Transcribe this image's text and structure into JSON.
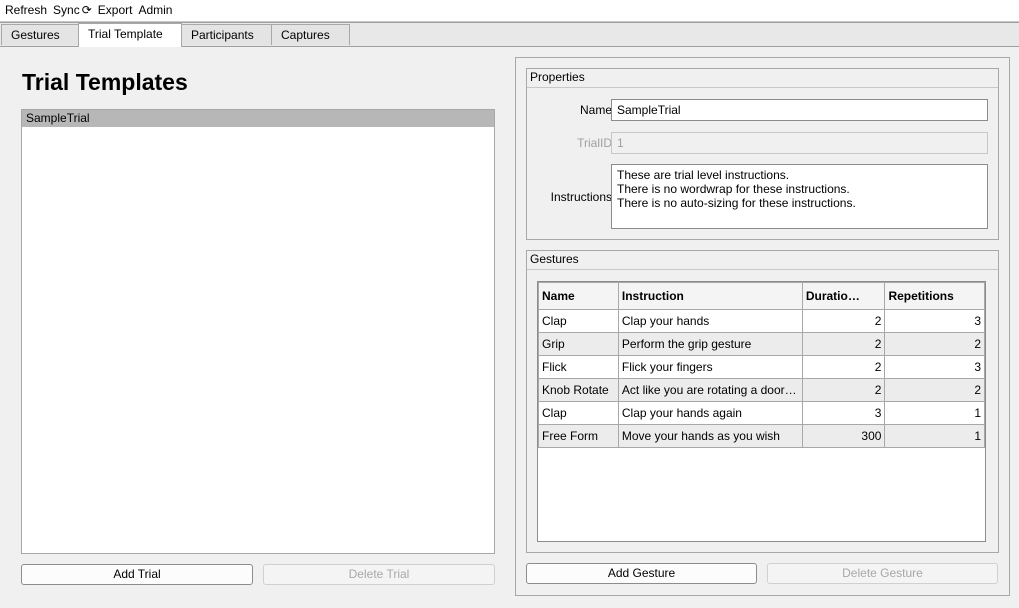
{
  "menu": {
    "refresh": "Refresh",
    "sync": "Sync",
    "sync_icon": "⟳",
    "export": "Export",
    "admin": "Admin"
  },
  "tabs": [
    "Gestures",
    "Trial Template",
    "Participants",
    "Captures"
  ],
  "active_tab": "Trial Template",
  "left": {
    "title": "Trial Templates",
    "list_items": [
      "SampleTrial"
    ],
    "add_button": "Add Trial",
    "delete_button": "Delete Trial"
  },
  "properties": {
    "title": "Properties",
    "name_label": "Name",
    "name_value": "SampleTrial",
    "trialid_label": "TrialID",
    "trialid_value": "1",
    "instructions_label": "Instructions",
    "instructions_lines": [
      "These are trial level instructions.",
      "There is no wordwrap for these instructions.",
      "There is no auto-sizing for these instructions."
    ]
  },
  "gestures": {
    "title": "Gestures",
    "columns": [
      "Name",
      "Instruction",
      "Duratio…",
      "Repetitions"
    ],
    "rows": [
      {
        "name": "Clap",
        "instruction": "Clap your hands",
        "duration": "2",
        "repetitions": "3"
      },
      {
        "name": "Grip",
        "instruction": "Perform the grip gesture",
        "duration": "2",
        "repetitions": "2"
      },
      {
        "name": "Flick",
        "instruction": "Flick your fingers",
        "duration": "2",
        "repetitions": "3"
      },
      {
        "name": "Knob Rotate",
        "instruction": "Act like you are rotating a door…",
        "duration": "2",
        "repetitions": "2"
      },
      {
        "name": "Clap",
        "instruction": "Clap your hands again",
        "duration": "3",
        "repetitions": "1"
      },
      {
        "name": "Free Form",
        "instruction": "Move your hands as you wish",
        "duration": "300",
        "repetitions": "1"
      }
    ],
    "add_button": "Add Gesture",
    "delete_button": "Delete Gesture"
  }
}
